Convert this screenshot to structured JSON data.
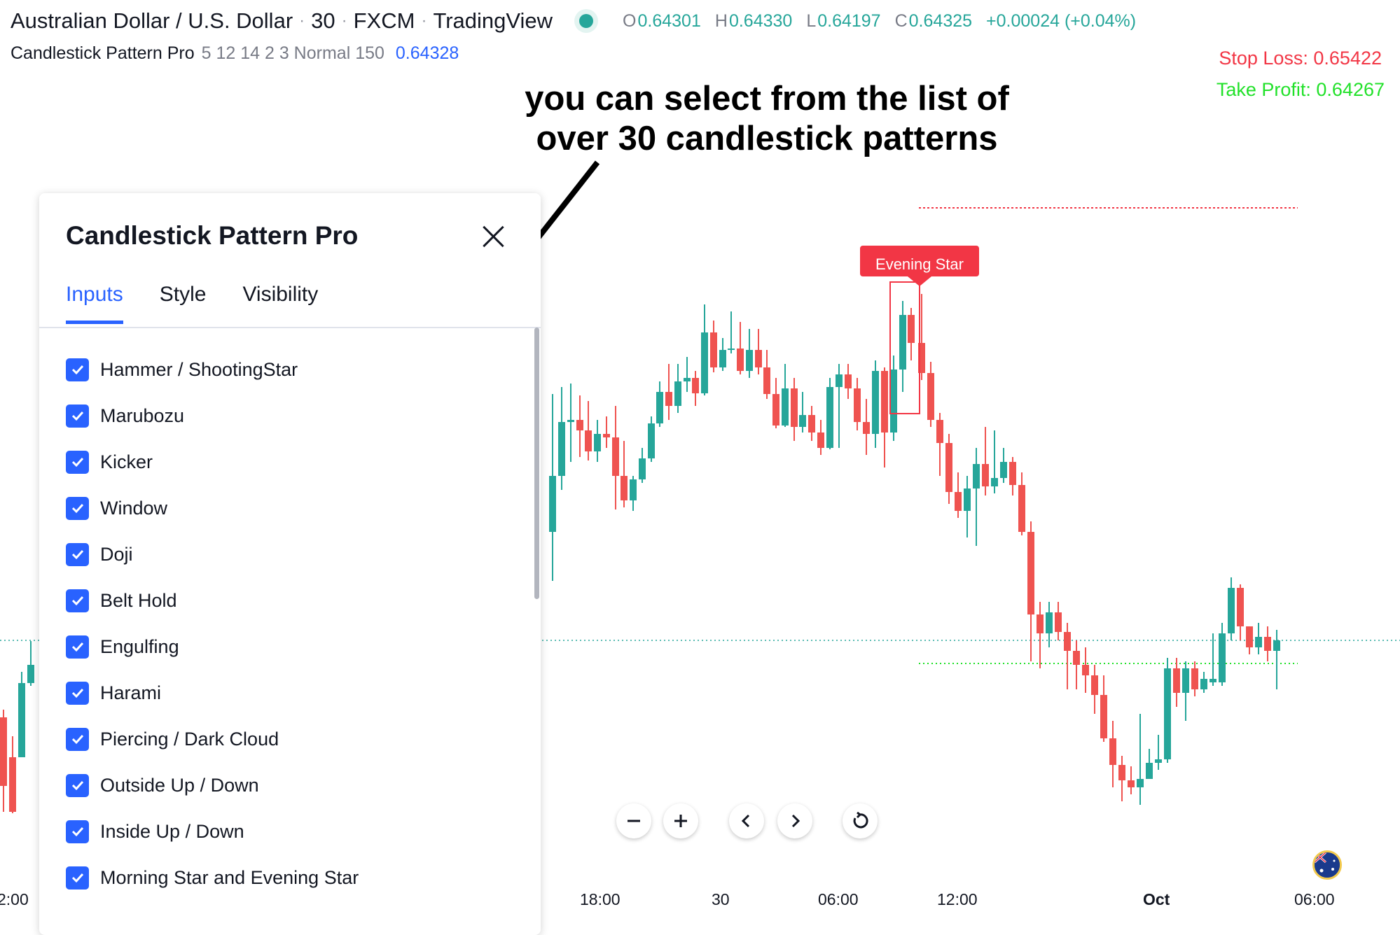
{
  "header": {
    "symbol": "Australian Dollar / U.S. Dollar",
    "interval": "30",
    "exchange": "FXCM",
    "platform": "TradingView",
    "ohlc": {
      "o_label": "O",
      "o": "0.64301",
      "h_label": "H",
      "h": "0.64330",
      "l_label": "L",
      "l": "0.64197",
      "c_label": "C",
      "c": "0.64325",
      "change": "+0.00024 (+0.04%)"
    },
    "indicator_name": "Candlestick Pattern Pro",
    "indicator_params": "5 12 14 2 3 Normal 150",
    "indicator_value": "0.64328"
  },
  "stop_loss": "Stop Loss: 0.65422",
  "take_profit": "Take Profit: 0.64267",
  "annotation": {
    "line1": "you can select from the list of",
    "line2": "over 30 candlestick patterns"
  },
  "pattern_label": "Evening Star",
  "dialog": {
    "title": "Candlestick Pattern Pro",
    "tabs": [
      {
        "label": "Inputs",
        "active": true
      },
      {
        "label": "Style",
        "active": false
      },
      {
        "label": "Visibility",
        "active": false
      }
    ],
    "patterns": [
      {
        "label": "Hammer / ShootingStar",
        "checked": true
      },
      {
        "label": "Marubozu",
        "checked": true
      },
      {
        "label": "Kicker",
        "checked": true
      },
      {
        "label": "Window",
        "checked": true
      },
      {
        "label": "Doji",
        "checked": true
      },
      {
        "label": "Belt Hold",
        "checked": true
      },
      {
        "label": "Engulfing",
        "checked": true
      },
      {
        "label": "Harami",
        "checked": true
      },
      {
        "label": "Piercing / Dark Cloud",
        "checked": true
      },
      {
        "label": "Outside Up / Down",
        "checked": true
      },
      {
        "label": "Inside Up / Down",
        "checked": true
      },
      {
        "label": "Morning Star and Evening Star",
        "checked": true
      }
    ]
  },
  "time_axis": [
    "2:00",
    "18:00",
    "30",
    "06:00",
    "12:00",
    "Oct",
    "06:00"
  ],
  "controls": [
    "zoom-out",
    "zoom-in",
    "scroll-left",
    "scroll-right",
    "reset"
  ],
  "colors": {
    "up": "#26a69a",
    "down": "#ef5350",
    "accent": "#2962ff",
    "stop_loss": "#f23645",
    "take_profit": "#22e12a"
  }
}
